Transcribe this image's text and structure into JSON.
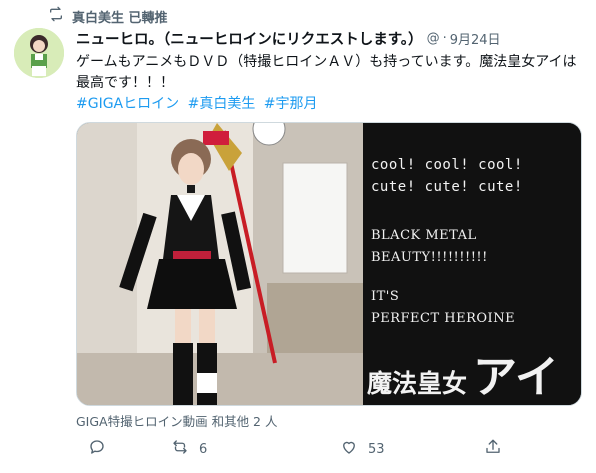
{
  "retweet": {
    "label": "真白美生 已轉推"
  },
  "tweet": {
    "display_name": "ニューヒロ。（ニューヒロインにリクエストします。）",
    "handle": "@",
    "dot": "·",
    "date": "9月24日",
    "text": "ゲームもアニメもＤＶＤ（特撮ヒロインＡＶ）も持っています。魔法皇女アイは最高です！！！",
    "hashtags": [
      "#GIGAヒロイン",
      "#真白美生",
      "#宇那月"
    ]
  },
  "media": {
    "lines": [
      "cool! cool! cool!",
      "cute! cute! cute!",
      "BLACK METAL",
      "BEAUTY!!!!!!!!!!",
      "IT'S",
      "PERFECT HEROINE"
    ],
    "title_small": "魔法皇女",
    "title_large": "アイ"
  },
  "tagline": "GIGA特撮ヒロイン動画 和其他 2 人",
  "actions": {
    "reply_count": "",
    "retweet_count": "6",
    "like_count": "53",
    "share_count": ""
  },
  "colors": {
    "accent": "#1d9bf0",
    "muted": "#536471",
    "text": "#0f1419"
  }
}
